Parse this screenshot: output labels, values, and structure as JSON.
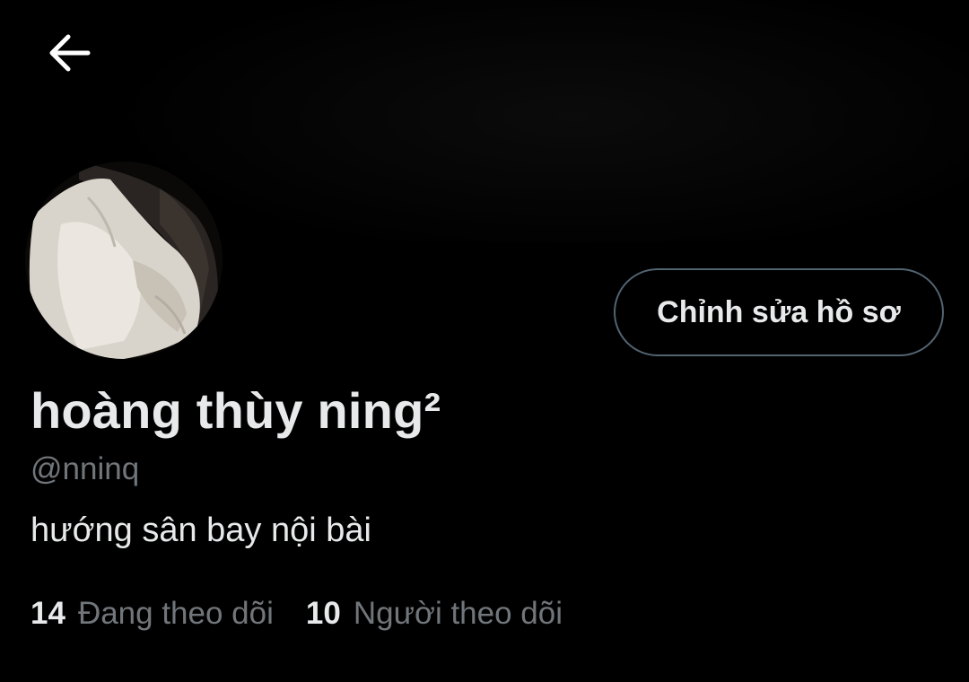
{
  "header": {
    "back_icon": "arrow-left-icon"
  },
  "profile": {
    "edit_button_label": "Chỉnh sửa hồ sơ",
    "display_name": "hoàng thùy ning²",
    "handle": "@nninq",
    "bio": "hướng sân bay nội bài"
  },
  "stats": {
    "following_count": "14",
    "following_label": "Đang theo dõi",
    "followers_count": "10",
    "followers_label": "Người theo dõi"
  },
  "colors": {
    "background": "#000000",
    "primary_text": "#e7e9ea",
    "secondary_text": "#71767b",
    "button_border": "#536471"
  }
}
